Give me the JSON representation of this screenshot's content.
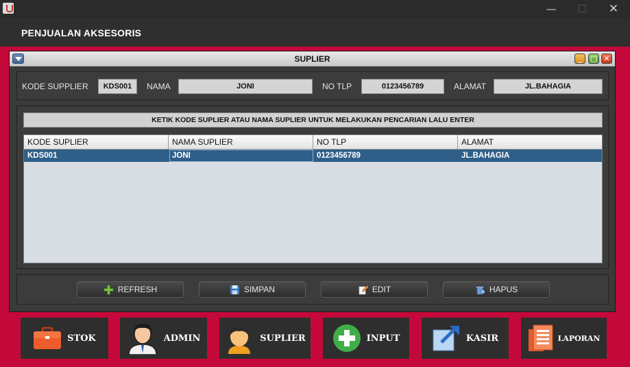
{
  "window": {
    "minimize": "—",
    "maximize": "☐",
    "close": "✕"
  },
  "app": {
    "title": "PENJUALAN AKSESORIS"
  },
  "internal_frame": {
    "title": "SUPLIER",
    "min": "_",
    "max": "□",
    "close": "✕"
  },
  "form": {
    "kode_label": "KODE SUPPLIER",
    "kode_value": "KDS001",
    "nama_label": "NAMA",
    "nama_value": "JONI",
    "tlp_label": "NO TLP",
    "tlp_value": "0123456789",
    "alamat_label": "ALAMAT",
    "alamat_value": "JL.BAHAGIA"
  },
  "search": {
    "hint": "KETIK KODE SUPLIER ATAU NAMA SUPLIER UNTUK MELAKUKAN PENCARIAN LALU ENTER"
  },
  "table": {
    "columns": [
      "KODE SUPLIER",
      "NAMA SUPLIER",
      "NO TLP",
      "ALAMAT"
    ],
    "rows": [
      [
        "KDS001",
        "JONI",
        "0123456789",
        "JL.BAHAGIA"
      ]
    ]
  },
  "buttons": {
    "refresh": "REFRESH",
    "simpan": "SIMPAN",
    "edit": "EDIT",
    "hapus": "HAPUS"
  },
  "nav": {
    "stok": "STOK",
    "admin": "ADMIN",
    "suplier": "SUPLIER",
    "input": "INPUT",
    "kasir": "KASIR",
    "laporan": "LAPORAN"
  },
  "colors": {
    "accent": "#c4093a",
    "selection": "#2f5f88",
    "panel": "#3c3c3c"
  },
  "icons": {
    "refresh": "plus-icon",
    "simpan": "floppy-icon",
    "edit": "pencil-icon",
    "hapus": "trash-icon",
    "stok": "briefcase-icon",
    "admin": "person-icon",
    "suplier": "person-icon",
    "input": "plus-circle-icon",
    "kasir": "arrow-square-icon",
    "laporan": "document-icon"
  }
}
